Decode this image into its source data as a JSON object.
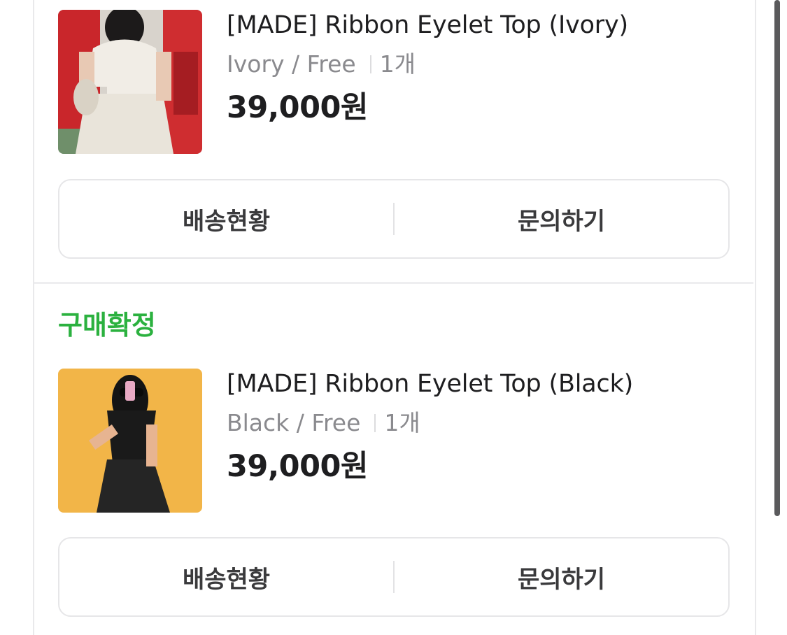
{
  "orders": [
    {
      "status": "",
      "product_name": "[MADE] Ribbon Eyelet Top (Ivory)",
      "option": "Ivory / Free",
      "quantity": "1개",
      "price": "39,000원",
      "buttons": {
        "tracking": "배송현황",
        "inquiry": "문의하기"
      }
    },
    {
      "status": "구매확정",
      "product_name": "[MADE] Ribbon Eyelet Top (Black)",
      "option": "Black / Free",
      "quantity": "1개",
      "price": "39,000원",
      "buttons": {
        "tracking": "배송현황",
        "inquiry": "문의하기"
      }
    }
  ],
  "colors": {
    "status_confirmed": "#2bb13f",
    "text_primary": "#1e1e20",
    "text_secondary": "#8a8a8e",
    "border": "#e6e6e8"
  }
}
